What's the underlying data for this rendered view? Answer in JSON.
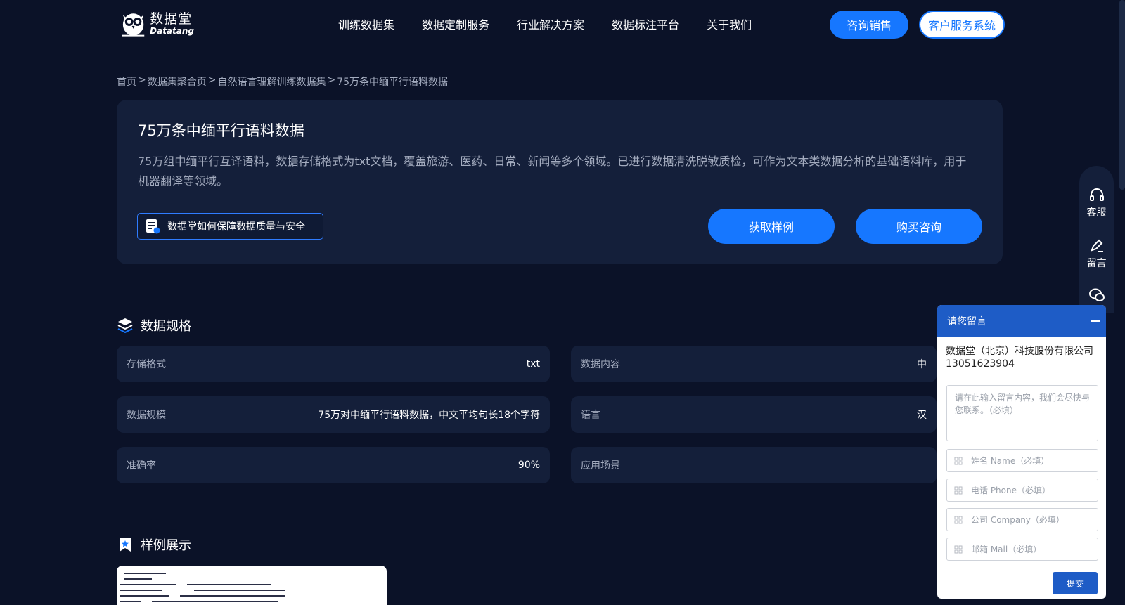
{
  "header": {
    "logo_cn": "数据堂",
    "logo_en": "Datatang",
    "nav": [
      "训练数据集",
      "数据定制服务",
      "行业解决方案",
      "数据标注平台",
      "关于我们"
    ],
    "sales_button": "咨询销售",
    "cs_button": "客户服务系统"
  },
  "breadcrumb": {
    "items": [
      "首页",
      "数据集聚合页",
      "自然语言理解训练数据集",
      "75万条中缅平行语料数据"
    ],
    "sep": ">"
  },
  "hero": {
    "title": "75万条中缅平行语料数据",
    "description": "75万组中缅平行互译语料，数据存储格式为txt文档，覆盖旅游、医药、日常、新闻等多个领域。已进行数据清洗脱敏质检，可作为文本类数据分析的基础语料库，用于机器翻译等领域。",
    "quality_link": "数据堂如何保障数据质量与安全",
    "sample_button": "获取样例",
    "buy_button": "购买咨询"
  },
  "specs_section": {
    "title": "数据规格",
    "items": [
      {
        "key": "存储格式",
        "value": "txt"
      },
      {
        "key": "数据内容",
        "value": "中"
      },
      {
        "key": "数据规模",
        "value": "75万对中缅平行语料数据，中文平均句长18个字符"
      },
      {
        "key": "语言",
        "value": "汉"
      },
      {
        "key": "准确率",
        "value": "90%"
      },
      {
        "key": "应用场景",
        "value": ""
      }
    ]
  },
  "sample_section": {
    "title": "样例展示"
  },
  "toolbar": {
    "items": [
      {
        "label": "客服",
        "icon": "headset-icon"
      },
      {
        "label": "留言",
        "icon": "edit-icon"
      },
      {
        "label": "",
        "icon": "wechat-icon"
      }
    ]
  },
  "message_panel": {
    "title": "请您留言",
    "company": "数据堂（北京）科技股份有限公司",
    "phone": "13051623904",
    "textarea_placeholder": "请在此输入留言内容，我们会尽快与您联系。（必填）",
    "name_placeholder": "姓名 Name（必填）",
    "phone_placeholder": "电话 Phone（必填）",
    "company_placeholder": "公司 Company（必填）",
    "mail_placeholder": "邮箱 Mail（必填）",
    "submit": "提交"
  },
  "colors": {
    "background": "#0b1228",
    "card": "#141f3a",
    "accent": "#1677ff",
    "panel_header": "#1e5cc6"
  }
}
